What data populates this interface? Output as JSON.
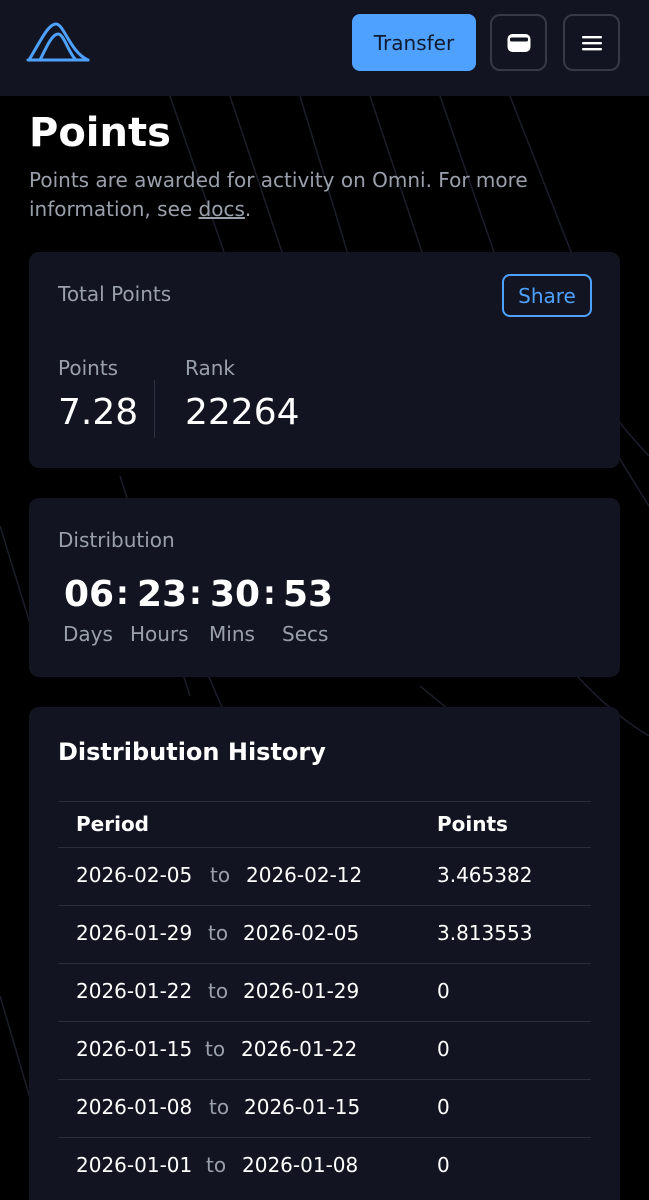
{
  "header": {
    "transfer_label": "Transfer",
    "icons": [
      "logo-icon",
      "wallet-icon",
      "menu-icon"
    ]
  },
  "page": {
    "title": "Points",
    "subtitle_text": "Points are awarded for activity on Omni. For more information, see ",
    "docs_link": "docs",
    "subtitle_end": "."
  },
  "total": {
    "label": "Total Points",
    "share_label": "Share",
    "points_label": "Points",
    "points_value": "7.28",
    "rank_label": "Rank",
    "rank_value": "22264"
  },
  "distribution": {
    "label": "Distribution",
    "days": "06",
    "hours": "23",
    "mins": "30",
    "secs": "53",
    "separator": ":",
    "days_label": "Days",
    "hours_label": "Hours",
    "mins_label": "Mins",
    "secs_label": "Secs"
  },
  "history": {
    "title": "Distribution History",
    "col_period": "Period",
    "col_points": "Points",
    "to_word": "to",
    "rows": [
      {
        "start": "2026-02-05",
        "end": "2026-02-12",
        "points": "3.465382"
      },
      {
        "start": "2026-01-29",
        "end": "2026-02-05",
        "points": "3.813553"
      },
      {
        "start": "2026-01-22",
        "end": "2026-01-29",
        "points": "0"
      },
      {
        "start": "2026-01-15",
        "end": "2026-01-22",
        "points": "0"
      },
      {
        "start": "2026-01-08",
        "end": "2026-01-15",
        "points": "0"
      },
      {
        "start": "2026-01-01",
        "end": "2026-01-08",
        "points": "0"
      }
    ]
  },
  "colors": {
    "accent": "#4ea1ff",
    "background": "#000000",
    "card": "#121521",
    "muted_text": "#9aa0ab"
  }
}
